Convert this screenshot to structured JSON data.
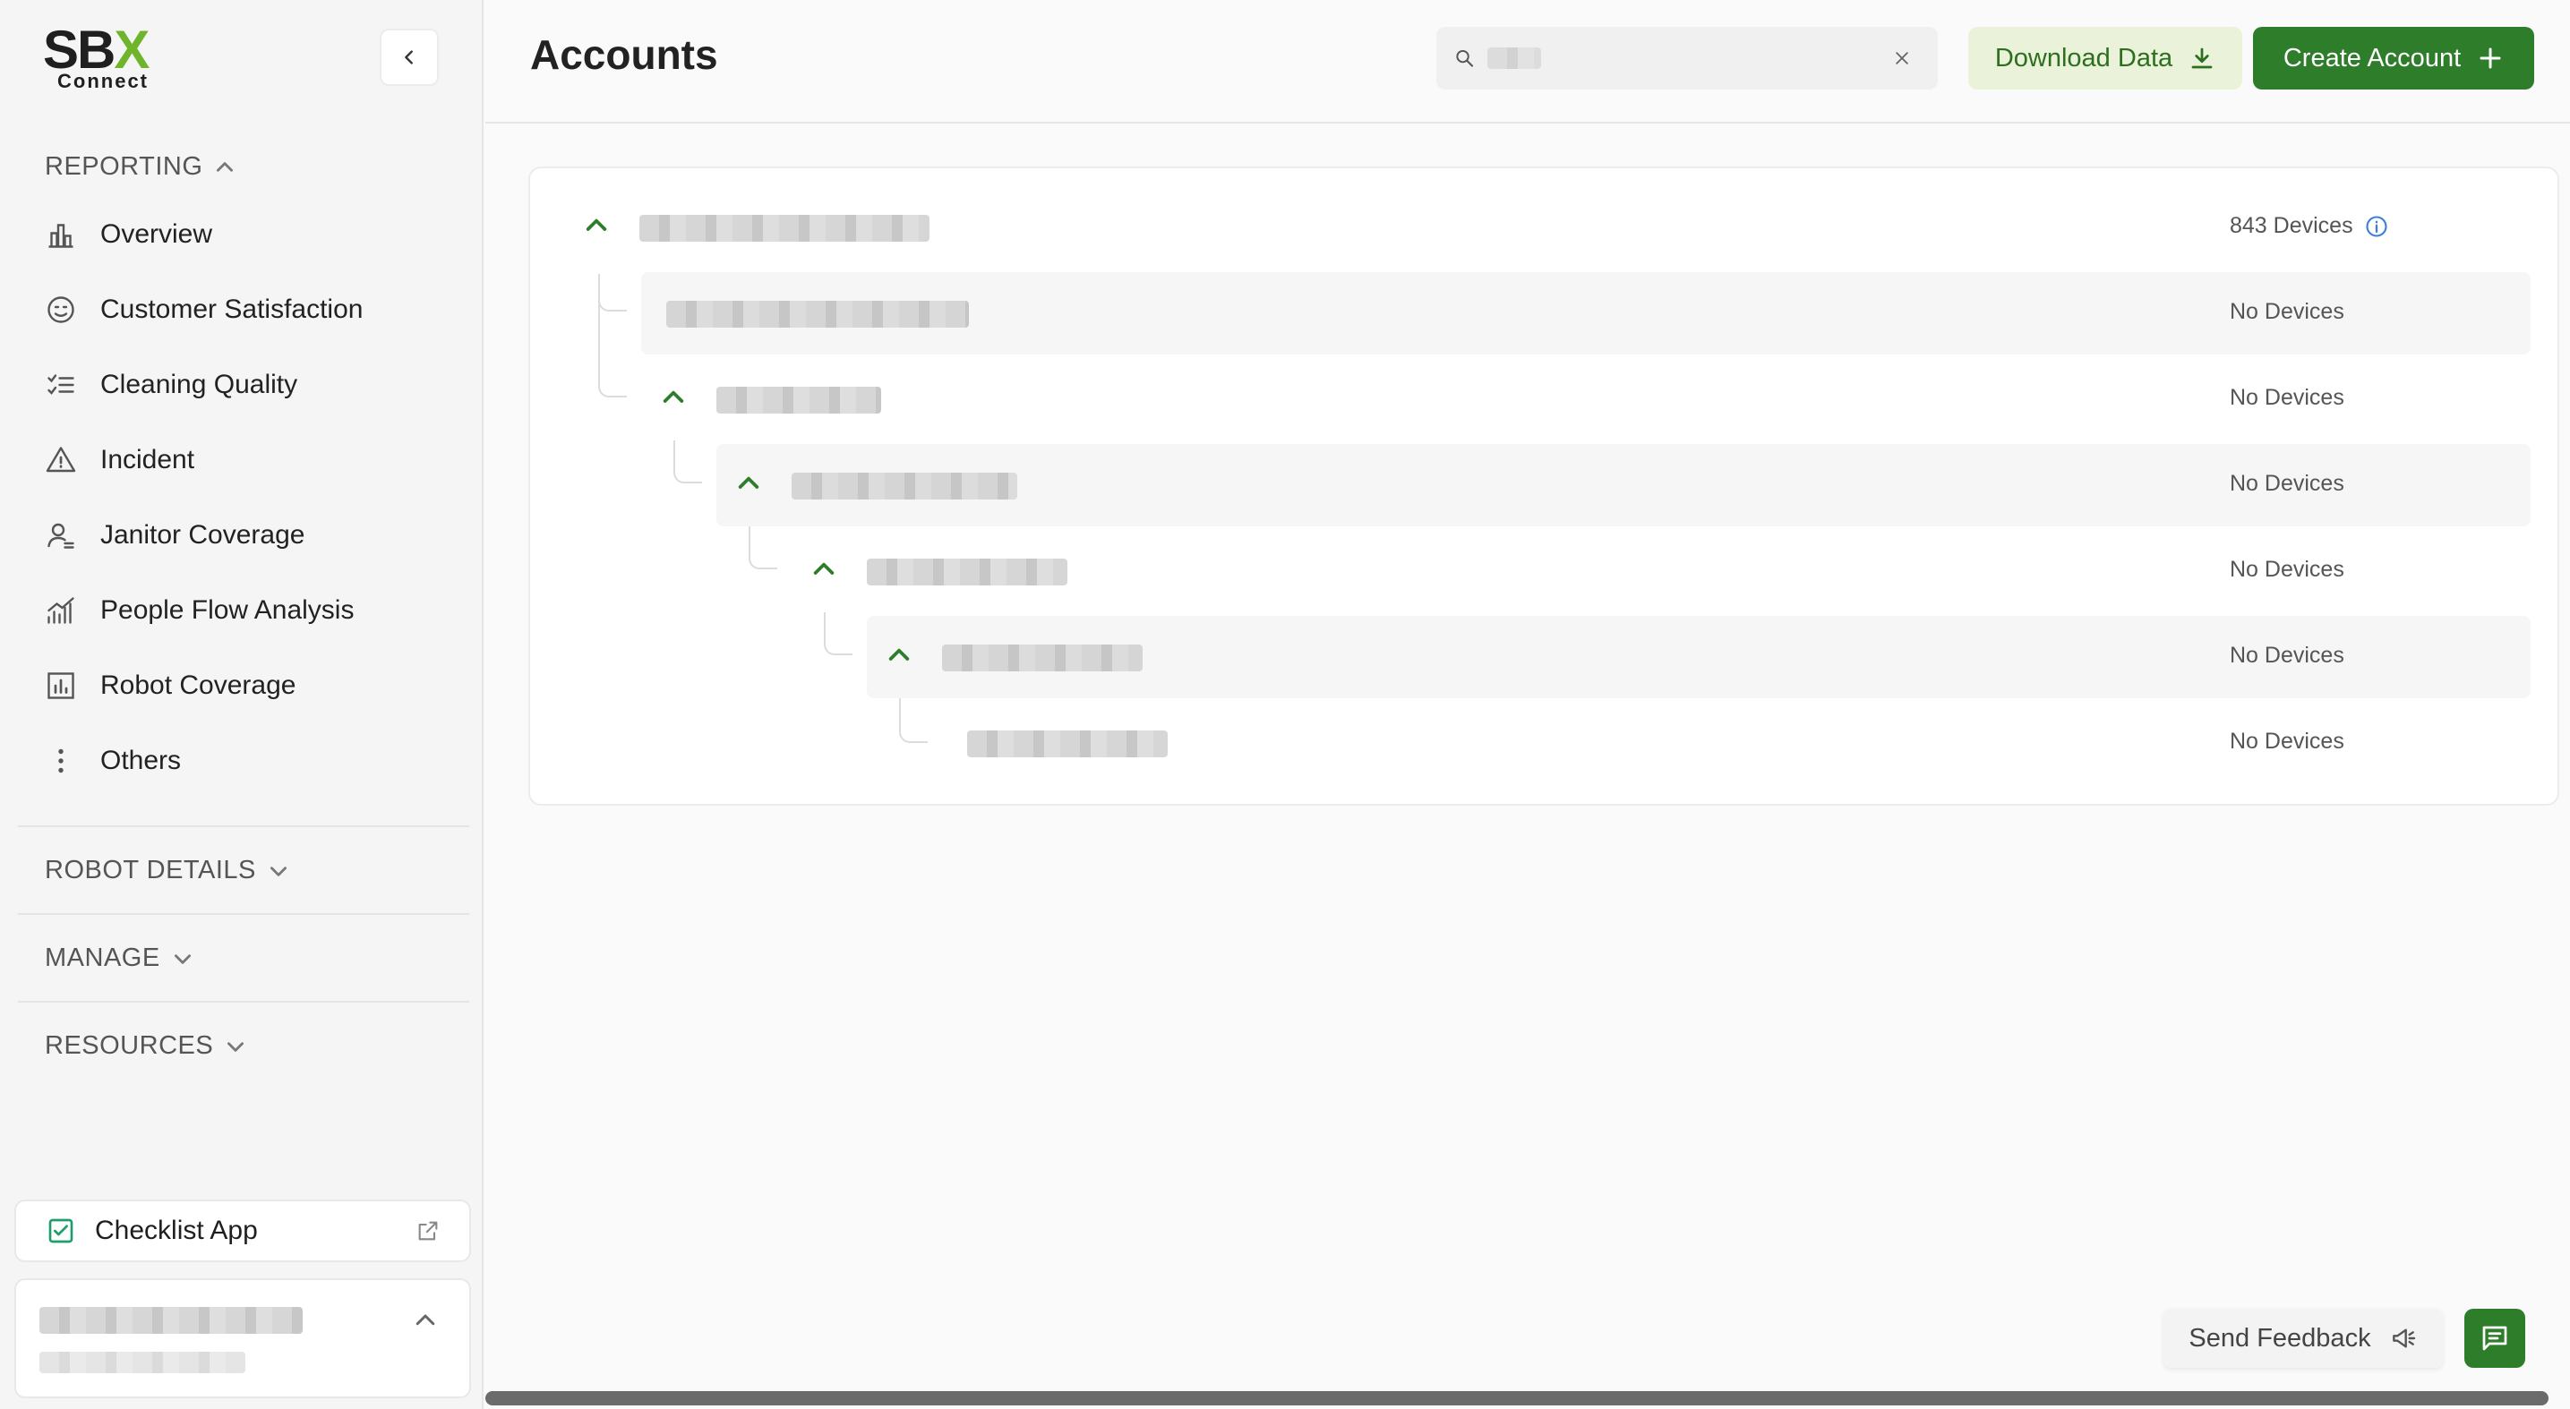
{
  "brand": {
    "logo_main": "SB",
    "logo_x": "X",
    "logo_sub": "Connect"
  },
  "sidebar": {
    "reporting_label": "REPORTING",
    "items": [
      {
        "label": "Overview",
        "icon": "bar-chart-icon"
      },
      {
        "label": "Customer Satisfaction",
        "icon": "smiley-icon"
      },
      {
        "label": "Cleaning Quality",
        "icon": "checklist-icon"
      },
      {
        "label": "Incident",
        "icon": "warning-icon"
      },
      {
        "label": "Janitor Coverage",
        "icon": "person-icon"
      },
      {
        "label": "People Flow Analysis",
        "icon": "trend-chart-icon"
      },
      {
        "label": "Robot Coverage",
        "icon": "grid-chart-icon"
      },
      {
        "label": "Others",
        "icon": "dots-vertical-icon"
      }
    ],
    "robot_details_label": "ROBOT DETAILS",
    "manage_label": "MANAGE",
    "resources_label": "RESOURCES",
    "checklist_label": "Checklist App"
  },
  "header": {
    "title": "Accounts",
    "download_label": "Download Data",
    "create_label": "Create Account"
  },
  "tree": {
    "rows": [
      {
        "count": "843 Devices"
      },
      {
        "count": "No Devices"
      },
      {
        "count": "No Devices"
      },
      {
        "count": "No Devices"
      },
      {
        "count": "No Devices"
      },
      {
        "count": "No Devices"
      },
      {
        "count": "No Devices"
      }
    ]
  },
  "feedback": {
    "label": "Send Feedback"
  },
  "colors": {
    "accent": "#2e7d2a",
    "accent_light": "#eaf3d9",
    "logo_green": "#6fb52c"
  }
}
